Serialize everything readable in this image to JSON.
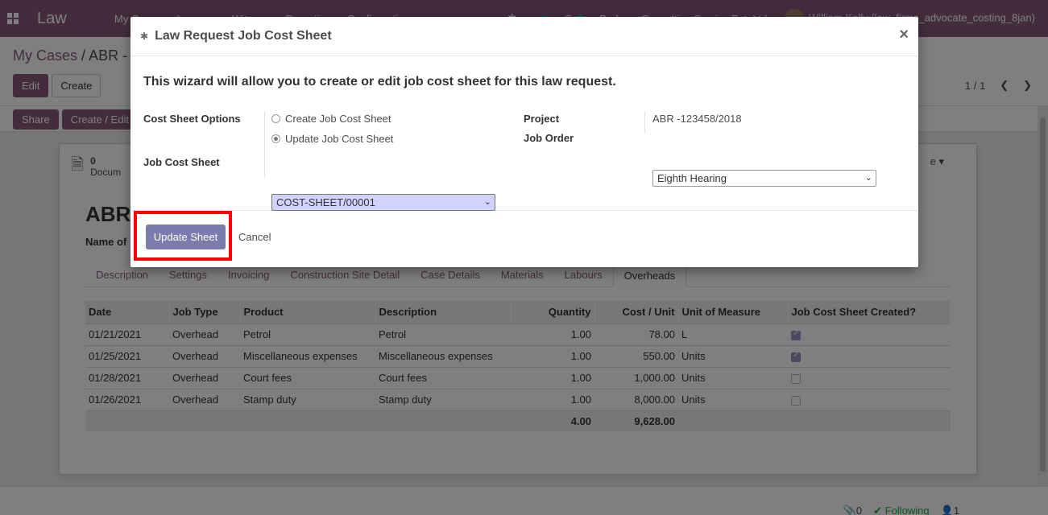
{
  "topbar": {
    "app_title": "Law",
    "menu": [
      "My Cases",
      "Lawyers",
      "Witness",
      "Reporting",
      "Configuration"
    ],
    "chat_count": "5",
    "activity_count": "5",
    "company": "Probuse Consulting Service Pvt. Ltd.",
    "user": "William Kelly (law_firms_advocate_costing_8jan)"
  },
  "control_panel": {
    "breadcrumb_parent": "My Cases",
    "breadcrumb_sep": "/",
    "breadcrumb_current": "ABR -",
    "edit_label": "Edit",
    "create_label": "Create",
    "pager_value": "1 / 1",
    "share_label": "Share",
    "create_edit_label": "Create / Edit C"
  },
  "sheet": {
    "smart_count": "0",
    "smart_label": "Docum",
    "more_label": "e",
    "record_name": "ABR",
    "name_of_label": "Name of",
    "tabs": [
      "Description",
      "Settings",
      "Invoicing",
      "Construction Site Detail",
      "Case Details",
      "Materials",
      "Labours",
      "Overheads"
    ],
    "active_tab": "Overheads",
    "columns": [
      "Date",
      "Job Type",
      "Product",
      "Description",
      "Quantity",
      "Cost / Unit",
      "Unit of Measure",
      "Job Cost Sheet Created?"
    ],
    "rows": [
      {
        "date": "01/21/2021",
        "job_type": "Overhead",
        "product": "Petrol",
        "description": "Petrol",
        "quantity": "1.00",
        "cost_unit": "78.00",
        "uom": "L",
        "created": true
      },
      {
        "date": "01/25/2021",
        "job_type": "Overhead",
        "product": "Miscellaneous expenses",
        "description": "Miscellaneous expenses",
        "quantity": "1.00",
        "cost_unit": "550.00",
        "uom": "Units",
        "created": true
      },
      {
        "date": "01/28/2021",
        "job_type": "Overhead",
        "product": "Court fees",
        "description": "Court fees",
        "quantity": "1.00",
        "cost_unit": "1,000.00",
        "uom": "Units",
        "created": false
      },
      {
        "date": "01/26/2021",
        "job_type": "Overhead",
        "product": "Stamp duty",
        "description": "Stamp duty",
        "quantity": "1.00",
        "cost_unit": "8,000.00",
        "uom": "Units",
        "created": false
      }
    ],
    "total_quantity": "4.00",
    "total_cost": "9,628.00"
  },
  "chatter": {
    "attachments": "0",
    "following": "Following",
    "followers": "1"
  },
  "modal": {
    "title": "Law Request Job Cost Sheet",
    "close": "×",
    "intro": "This wizard will allow you to create or edit job cost sheet for this law request.",
    "cost_sheet_options_label": "Cost Sheet Options",
    "option_create": "Create Job Cost Sheet",
    "option_update": "Update Job Cost Sheet",
    "selected_option": "update",
    "job_cost_sheet_label": "Job Cost Sheet",
    "job_cost_sheet_value": "COST-SHEET/00001",
    "project_label": "Project",
    "project_value": "ABR -123458/2018",
    "job_order_label": "Job Order",
    "job_order_value": "Eighth Hearing",
    "update_button": "Update Sheet",
    "cancel_button": "Cancel"
  },
  "colors": {
    "brand": "#875a7b",
    "update_button": "#7c7bad",
    "highlight": "#ff0000",
    "select_highlight": "#d2d2ff"
  }
}
